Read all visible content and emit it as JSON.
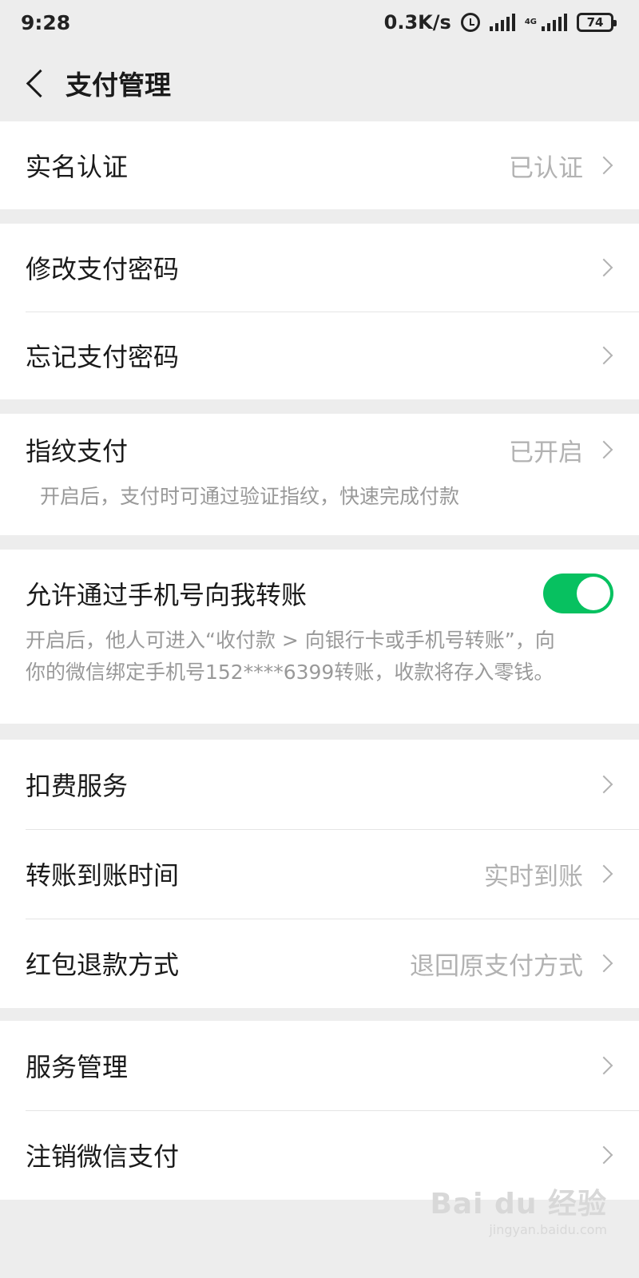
{
  "status_bar": {
    "time": "9:28",
    "net_speed": "0.3K/s",
    "net_type": "4G",
    "battery": "74"
  },
  "header": {
    "title": "支付管理"
  },
  "sections": {
    "verify": {
      "label": "实名认证",
      "value": "已认证"
    },
    "change_pwd": {
      "label": "修改支付密码"
    },
    "forget_pwd": {
      "label": "忘记支付密码"
    },
    "fingerprint": {
      "label": "指纹支付",
      "value": "已开启",
      "hint": "开启后，支付时可通过验证指纹，快速完成付款"
    },
    "phone_transfer": {
      "label": "允许通过手机号向我转账",
      "enabled": true,
      "hint_line1": "开启后，他人可进入“收付款 > 向银行卡或手机号转账”，向",
      "hint_line2": "你的微信绑定手机号152****6399转账，收款将存入零钱。"
    },
    "deduction": {
      "label": "扣费服务"
    },
    "arrival_time": {
      "label": "转账到账时间",
      "value": "实时到账"
    },
    "refund_method": {
      "label": "红包退款方式",
      "value": "退回原支付方式"
    },
    "service_mgmt": {
      "label": "服务管理"
    },
    "cancel_pay": {
      "label": "注销微信支付"
    }
  },
  "watermark": {
    "logo": "Bai du 经验",
    "url": "jingyan.baidu.com"
  },
  "colors": {
    "accent": "#07c160",
    "background": "#ededed",
    "secondary_text": "#b2b2b2"
  }
}
